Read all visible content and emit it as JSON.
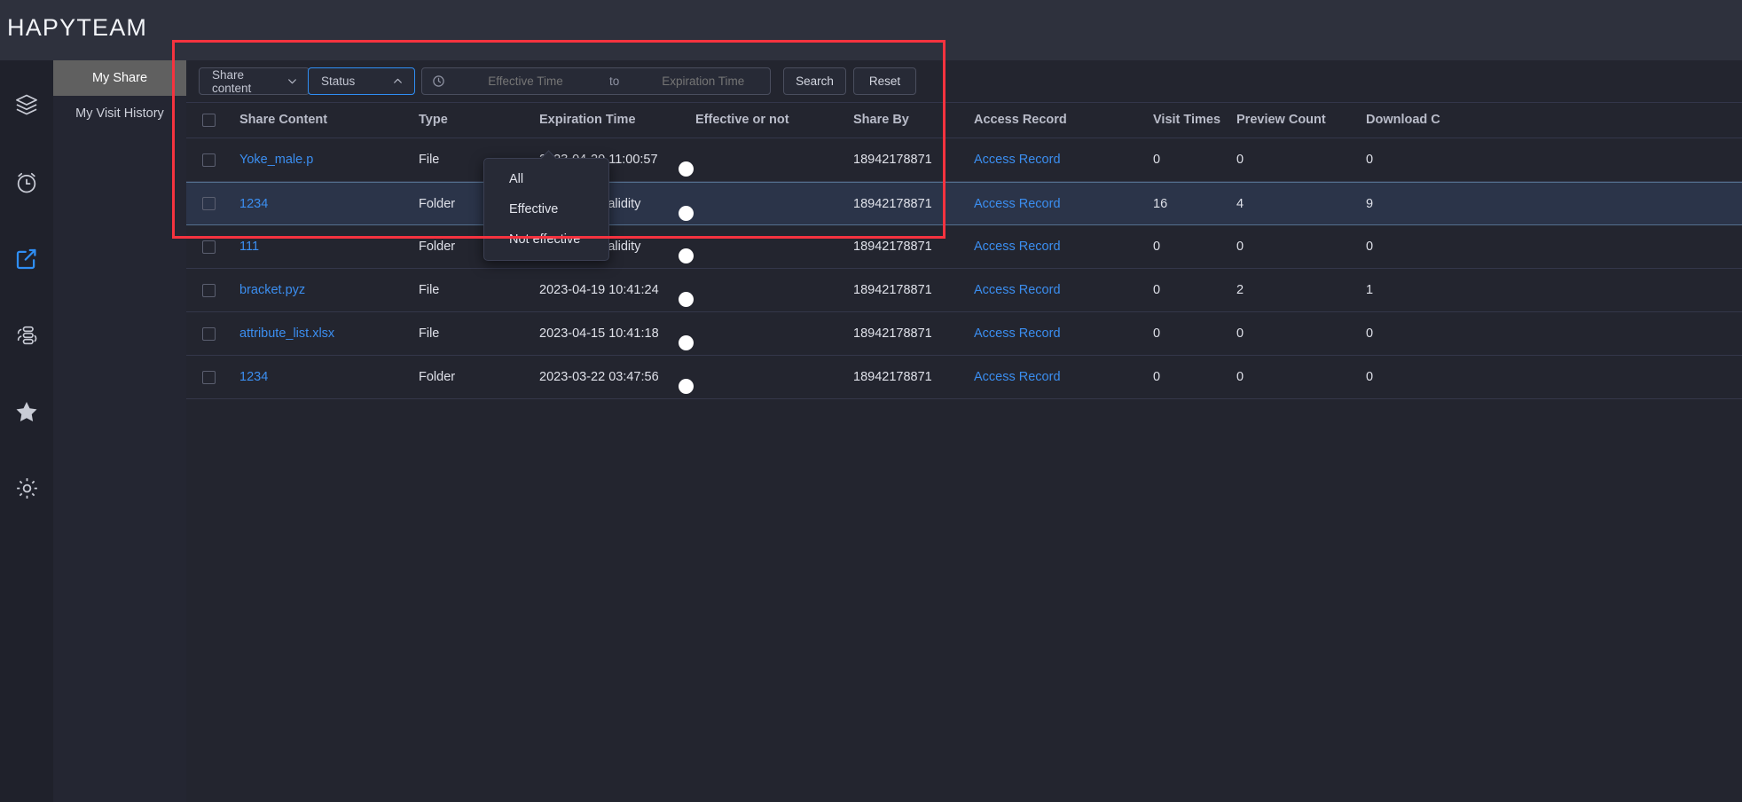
{
  "app": {
    "logo": "HAPYTEAM"
  },
  "rail": {
    "items": [
      {
        "name": "layers-icon",
        "active": false
      },
      {
        "name": "clock-icon",
        "active": false
      },
      {
        "name": "share-icon",
        "active": true
      },
      {
        "name": "transfer-icon",
        "active": false
      },
      {
        "name": "star-icon",
        "active": false
      },
      {
        "name": "gear-icon",
        "active": false
      }
    ]
  },
  "subnav": {
    "items": [
      {
        "label": "My Share"
      },
      {
        "label": "My Visit History"
      }
    ]
  },
  "toolbar": {
    "share_content_label": "Share content",
    "status_label": "Status",
    "effective_time_placeholder": "Effective Time",
    "range_separator": "to",
    "expiration_time_placeholder": "Expiration Time",
    "effective_time_value": "",
    "expiration_time_value": "",
    "search_label": "Search",
    "reset_label": "Reset"
  },
  "status_menu": {
    "open": true,
    "options": [
      {
        "label": "All"
      },
      {
        "label": "Effective"
      },
      {
        "label": "Not effective"
      }
    ]
  },
  "table": {
    "headers": {
      "share_content": "Share Content",
      "type": "Type",
      "expiration_time": "Expiration Time",
      "effective_or_not": "Effective or not",
      "share_by": "Share By",
      "access_record": "Access Record",
      "visit_times": "Visit Times",
      "preview_count": "Preview Count",
      "download_count": "Download C"
    },
    "rows": [
      {
        "name": "Yoke_male.p",
        "type": "File",
        "expiration": "2023-04-20 11:00:57",
        "effective": true,
        "share_by": "18942178871",
        "access": "Access Record",
        "visit": "0",
        "preview": "0",
        "download": "0",
        "selected": false
      },
      {
        "name": "1234",
        "type": "Folder",
        "expiration": "Long-term validity",
        "effective": true,
        "share_by": "18942178871",
        "access": "Access Record",
        "visit": "16",
        "preview": "4",
        "download": "9",
        "selected": true
      },
      {
        "name": "111",
        "type": "Folder",
        "expiration": "Long-term validity",
        "effective": true,
        "share_by": "18942178871",
        "access": "Access Record",
        "visit": "0",
        "preview": "0",
        "download": "0",
        "selected": false
      },
      {
        "name": "bracket.pyz",
        "type": "File",
        "expiration": "2023-04-19 10:41:24",
        "effective": true,
        "share_by": "18942178871",
        "access": "Access Record",
        "visit": "0",
        "preview": "2",
        "download": "1",
        "selected": false
      },
      {
        "name": "attribute_list.xlsx",
        "type": "File",
        "expiration": "2023-04-15 10:41:18",
        "effective": true,
        "share_by": "18942178871",
        "access": "Access Record",
        "visit": "0",
        "preview": "0",
        "download": "0",
        "selected": false
      },
      {
        "name": "1234",
        "type": "Folder",
        "expiration": "2023-03-22 03:47:56",
        "effective": true,
        "share_by": "18942178871",
        "access": "Access Record",
        "visit": "0",
        "preview": "0",
        "download": "0",
        "selected": false
      }
    ]
  },
  "colors": {
    "accent_blue": "#3b8ef0",
    "toggle_on": "#13ce66",
    "annotation_red": "#f5333f",
    "selected_row": "#2b3449"
  }
}
